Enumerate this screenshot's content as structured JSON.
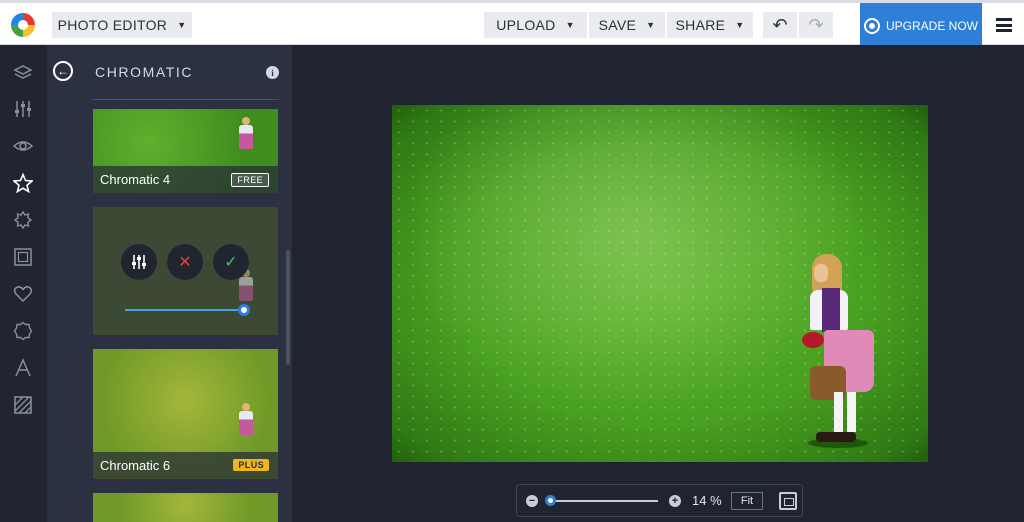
{
  "topbar": {
    "menu_label": "PHOTO EDITOR",
    "upload_label": "UPLOAD",
    "save_label": "SAVE",
    "share_label": "SHARE",
    "upgrade_label": "UPGRADE NOW"
  },
  "rail": {
    "icons": [
      "layers-icon",
      "adjust-icon",
      "eye-icon",
      "star-icon",
      "gear-flower-icon",
      "frame-icon",
      "heart-icon",
      "badge-icon",
      "text-icon",
      "texture-icon"
    ],
    "active": "star-icon"
  },
  "panel": {
    "title": "CHROMATIC",
    "thumbnails": [
      {
        "label": "Chromatic 4",
        "tag": "FREE"
      },
      {
        "label": "Chromatic 6",
        "tag": "PLUS"
      }
    ],
    "slider_value": 1.0
  },
  "zoom": {
    "value": "14 %",
    "fit_label": "Fit",
    "level": 0.0
  },
  "colors": {
    "accent": "#2d7fd7",
    "plus_tag": "#f2b51b",
    "cancel": "#e0443a",
    "confirm": "#3cc75a"
  }
}
